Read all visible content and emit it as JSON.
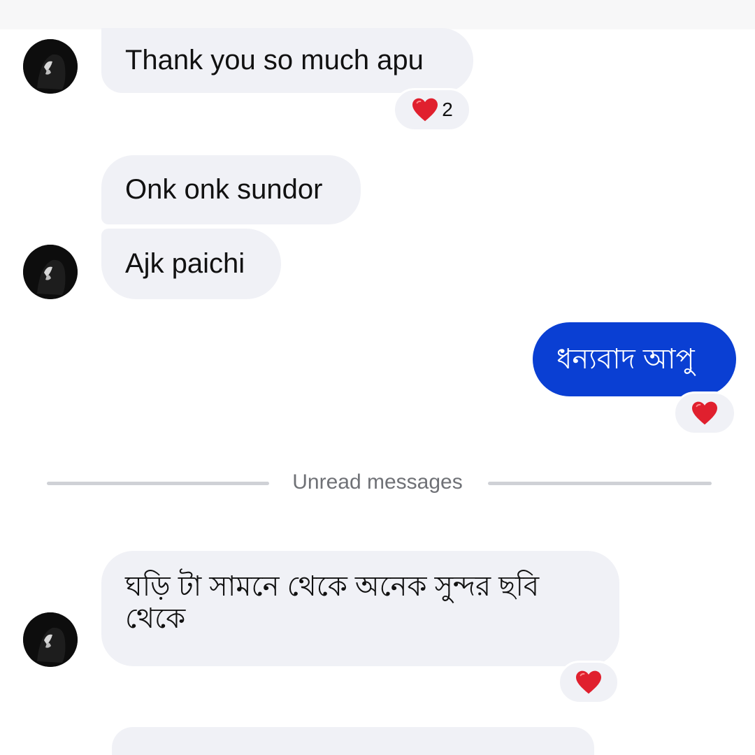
{
  "messages": [
    {
      "text": "Thank you so much apu",
      "reaction": {
        "icon": "heart-icon",
        "count": "2"
      }
    },
    {
      "text": "Onk onk sundor"
    },
    {
      "text": "Ajk paichi"
    },
    {
      "text": "ধন্যবাদ আপু",
      "reaction": {
        "icon": "heart-icon"
      }
    },
    {
      "text": "ঘড়ি টা সামনে থেকে অনেক সুন্দর ছবি থেকে",
      "reaction": {
        "icon": "heart-icon"
      }
    }
  ],
  "divider": {
    "label": "Unread messages"
  },
  "colors": {
    "sent_bubble": "#0a3fd3",
    "received_bubble": "#f0f1f6",
    "heart": "#e0202e"
  }
}
